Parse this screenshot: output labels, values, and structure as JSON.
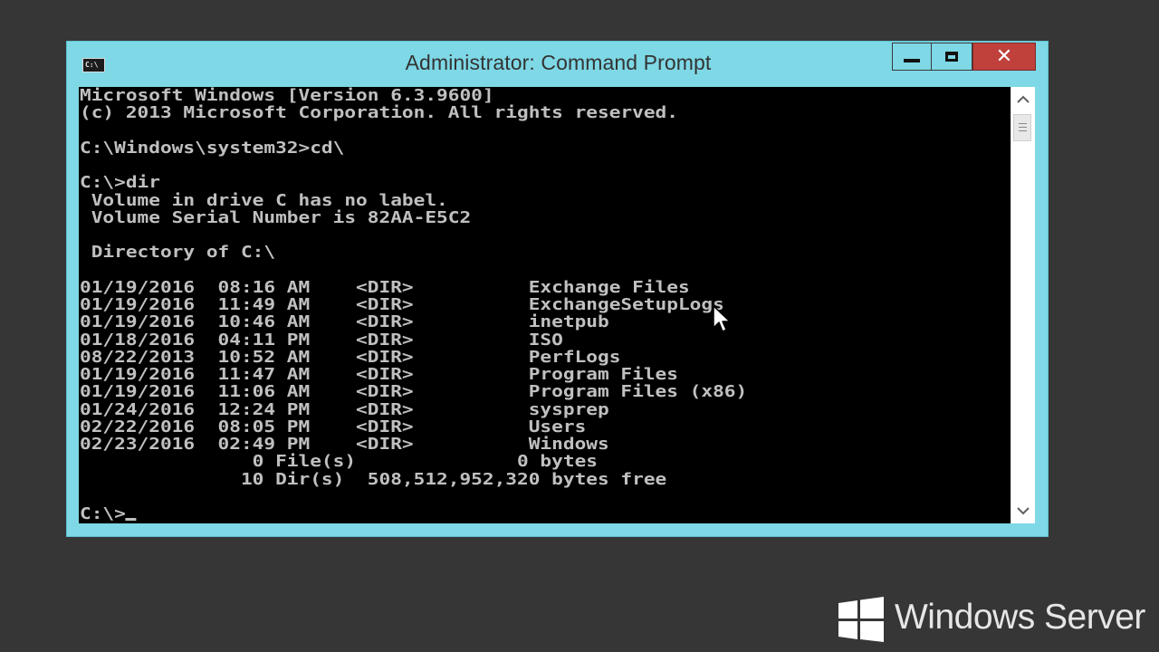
{
  "window": {
    "title": "Administrator: Command Prompt",
    "icon_label": "C:\\",
    "controls": {
      "minimize": "minimize-icon",
      "maximize": "maximize-icon",
      "close": "✕"
    }
  },
  "console": {
    "lines": [
      "Microsoft Windows [Version 6.3.9600]",
      "(c) 2013 Microsoft Corporation. All rights reserved.",
      "",
      "C:\\Windows\\system32>cd\\",
      "",
      "C:\\>dir",
      " Volume in drive C has no label.",
      " Volume Serial Number is 82AA-E5C2",
      "",
      " Directory of C:\\",
      "",
      "01/19/2016  08:16 AM    <DIR>          Exchange Files",
      "01/19/2016  11:49 AM    <DIR>          ExchangeSetupLogs",
      "01/19/2016  10:46 AM    <DIR>          inetpub",
      "01/18/2016  04:11 PM    <DIR>          ISO",
      "08/22/2013  10:52 AM    <DIR>          PerfLogs",
      "01/19/2016  11:47 AM    <DIR>          Program Files",
      "01/19/2016  11:06 AM    <DIR>          Program Files (x86)",
      "01/24/2016  12:24 PM    <DIR>          sysprep",
      "02/22/2016  08:05 PM    <DIR>          Users",
      "02/23/2016  02:49 PM    <DIR>          Windows",
      "               0 File(s)              0 bytes",
      "              10 Dir(s)  508,512,952,320 bytes free",
      ""
    ],
    "prompt": "C:\\>"
  },
  "scrollbar": {
    "up_icon": "▲",
    "down_icon": "▼"
  },
  "brand": {
    "text": "Windows Server",
    "logo": "windows-logo"
  },
  "colors": {
    "titlebar": "#7ed8e6",
    "close_button": "#c0403b",
    "console_bg": "#000000",
    "console_fg": "#c0c0c0",
    "desktop_bg": "#363636"
  }
}
